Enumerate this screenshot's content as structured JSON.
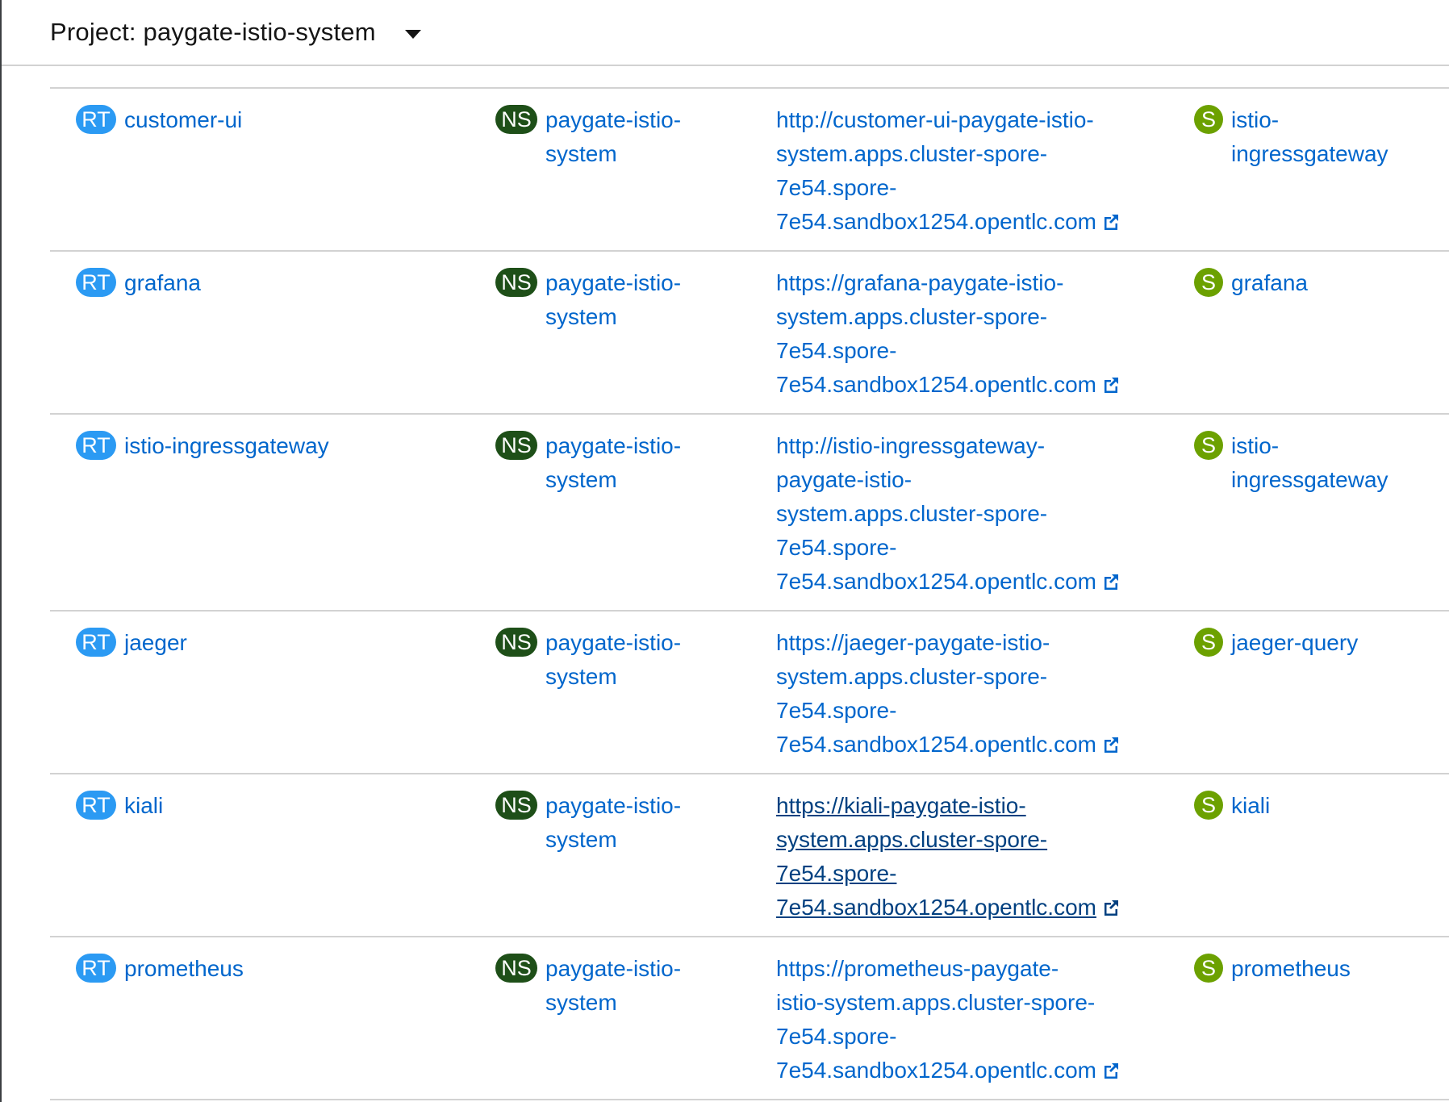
{
  "project": {
    "label": "Project: paygate-istio-system"
  },
  "badges": {
    "route": "RT",
    "namespace": "NS",
    "service": "S"
  },
  "routes": [
    {
      "name": "customer-ui",
      "namespace_line1": "paygate-istio-",
      "namespace_line2": "system",
      "location_lines": [
        "http://customer-ui-paygate-istio-",
        "system.apps.cluster-spore-",
        "7e54.spore-",
        "7e54.sandbox1254.opentlc.com"
      ],
      "service_line1": "istio-",
      "service_line2": "ingressgateway"
    },
    {
      "name": "grafana",
      "namespace_line1": "paygate-istio-",
      "namespace_line2": "system",
      "location_lines": [
        "https://grafana-paygate-istio-",
        "system.apps.cluster-spore-",
        "7e54.spore-",
        "7e54.sandbox1254.opentlc.com"
      ],
      "service_line1": "grafana",
      "service_line2": ""
    },
    {
      "name": "istio-ingressgateway",
      "namespace_line1": "paygate-istio-",
      "namespace_line2": "system",
      "location_lines": [
        "http://istio-ingressgateway-",
        "paygate-istio-",
        "system.apps.cluster-spore-",
        "7e54.spore-",
        "7e54.sandbox1254.opentlc.com"
      ],
      "service_line1": "istio-",
      "service_line2": "ingressgateway"
    },
    {
      "name": "jaeger",
      "namespace_line1": "paygate-istio-",
      "namespace_line2": "system",
      "location_lines": [
        "https://jaeger-paygate-istio-",
        "system.apps.cluster-spore-",
        "7e54.spore-",
        "7e54.sandbox1254.opentlc.com"
      ],
      "service_line1": "jaeger-query",
      "service_line2": ""
    },
    {
      "name": "kiali",
      "namespace_line1": "paygate-istio-",
      "namespace_line2": "system",
      "location_lines": [
        "https://kiali-paygate-istio-",
        "system.apps.cluster-spore-",
        "7e54.spore-",
        "7e54.sandbox1254.opentlc.com"
      ],
      "service_line1": "kiali",
      "service_line2": ""
    },
    {
      "name": "prometheus",
      "namespace_line1": "paygate-istio-",
      "namespace_line2": "system",
      "location_lines": [
        "https://prometheus-paygate-",
        "istio-system.apps.cluster-spore-",
        "7e54.spore-",
        "7e54.sandbox1254.opentlc.com"
      ],
      "service_line1": "prometheus",
      "service_line2": ""
    }
  ],
  "colors": {
    "link": "#0066cc",
    "route_badge": "#2b9af3",
    "namespace_badge": "#1e4f18",
    "service_badge": "#6ca100"
  },
  "icons": {
    "project_dropdown": "caret-down-icon",
    "external_link": "external-link-icon"
  }
}
